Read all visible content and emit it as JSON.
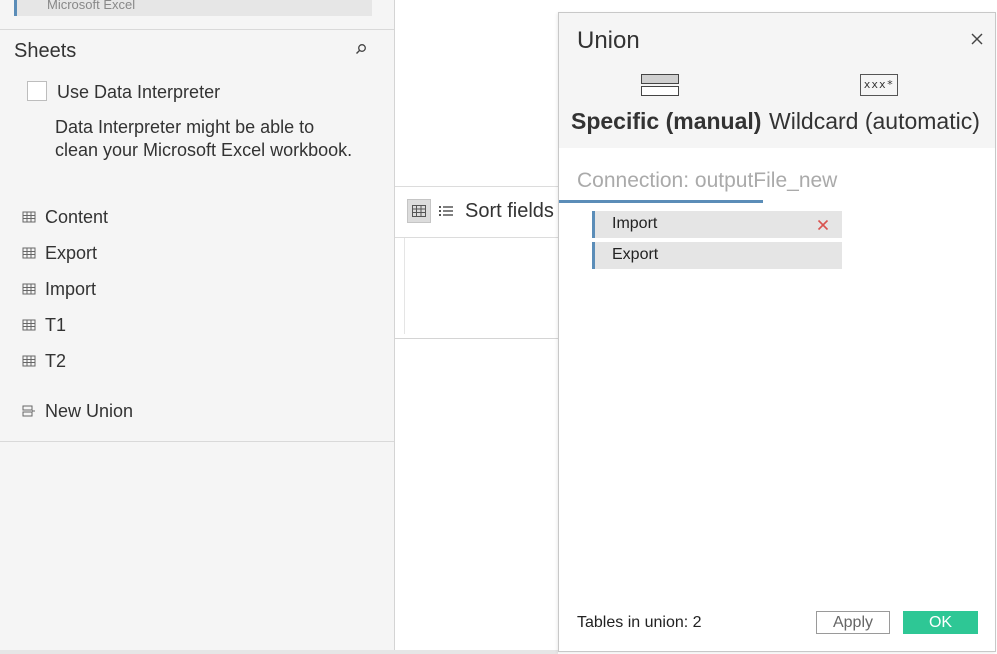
{
  "left_panel": {
    "connection_chip": "Microsoft Excel",
    "sheets_title": "Sheets",
    "data_interpreter": {
      "label": "Use Data Interpreter",
      "checked": false,
      "description": "Data Interpreter might be able to clean your Microsoft Excel workbook."
    },
    "sheets": [
      {
        "label": "Content",
        "icon": "table-icon"
      },
      {
        "label": "Export",
        "icon": "table-icon"
      },
      {
        "label": "Import",
        "icon": "table-icon"
      },
      {
        "label": "T1",
        "icon": "table-icon"
      },
      {
        "label": "T2",
        "icon": "table-icon"
      }
    ],
    "new_union": {
      "label": "New Union",
      "icon": "union-icon"
    }
  },
  "middle": {
    "sort_label": "Sort fields"
  },
  "dialog": {
    "title": "Union",
    "tabs": [
      {
        "label": "Specific (manual)",
        "active": true,
        "icon": "stacked-tables-icon"
      },
      {
        "label": "Wildcard (automatic)",
        "active": false,
        "icon": "wildcard-icon",
        "icon_text": "xxx*"
      }
    ],
    "connection_label": "Connection: outputFile_new",
    "tables": [
      {
        "label": "Import",
        "removable": true
      },
      {
        "label": "Export",
        "removable": false
      }
    ],
    "count_label": "Tables in union: 2",
    "apply_label": "Apply",
    "ok_label": "OK"
  },
  "colors": {
    "accent": "#5b8db8",
    "ok_green": "#2ec795",
    "remove_red": "#d9534f",
    "panel_bg": "#f5f5f5"
  }
}
